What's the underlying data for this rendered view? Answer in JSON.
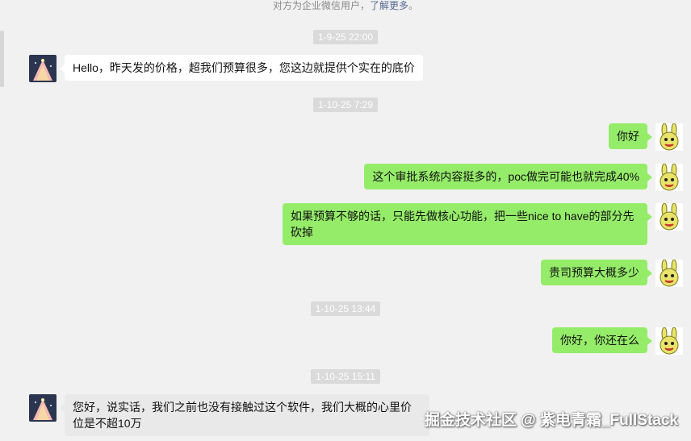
{
  "notice": {
    "text": "对方为企业微信用户，",
    "link": "了解更多",
    "suffix": "。"
  },
  "timestamps": [
    "1-9-25 22:00",
    "1-10-25 7:29",
    "1-10-25 13:44",
    "1-10-25 15:11"
  ],
  "messages": [
    {
      "side": "left",
      "text": "Hello，昨天发的价格，超我们预算很多，您这边就提供个实在的底价"
    },
    {
      "side": "right",
      "text": "你好"
    },
    {
      "side": "right",
      "text": "这个审批系统内容挺多的，poc做完可能也就完成40%"
    },
    {
      "side": "right",
      "text": "如果预算不够的话，只能先做核心功能，把一些nice to have的部分先砍掉"
    },
    {
      "side": "right",
      "text": "贵司预算大概多少"
    },
    {
      "side": "right",
      "text": "你好，你还在么"
    },
    {
      "side": "left",
      "text": "您好，说实话，我们之前也没有接触过这个软件，我们大概的心里价位是不超10万"
    }
  ],
  "watermark": "掘金技术社区 @ 紫电青霜_FullStack",
  "colors": {
    "outgoing": "#95ec69",
    "incoming": "#ffffff",
    "background": "#f1f1f1"
  }
}
